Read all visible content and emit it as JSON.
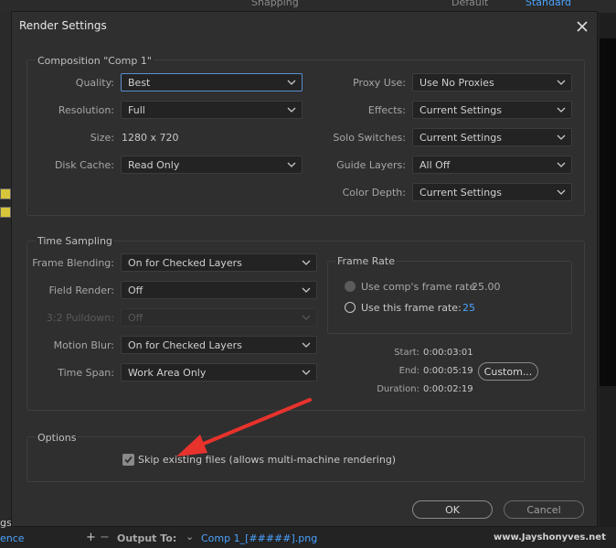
{
  "background": {
    "top_left_text": "Snapping",
    "top_right_tabs": [
      "Default",
      "Standard"
    ],
    "bottom_left_texts": [
      "gs",
      "ence"
    ],
    "output_to_label": "Output To:",
    "output_file": "Comp 1_[#####].png",
    "watermark": "www.Jayshonyves.net"
  },
  "dialog": {
    "title": "Render Settings",
    "composition": {
      "title": "Composition \"Comp 1\"",
      "quality_label": "Quality:",
      "quality_value": "Best",
      "resolution_label": "Resolution:",
      "resolution_value": "Full",
      "size_label": "Size:",
      "size_value": "1280 x 720",
      "disk_cache_label": "Disk Cache:",
      "disk_cache_value": "Read Only",
      "proxy_use_label": "Proxy Use:",
      "proxy_use_value": "Use No Proxies",
      "effects_label": "Effects:",
      "effects_value": "Current Settings",
      "solo_switches_label": "Solo Switches:",
      "solo_switches_value": "Current Settings",
      "guide_layers_label": "Guide Layers:",
      "guide_layers_value": "All Off",
      "color_depth_label": "Color Depth:",
      "color_depth_value": "Current Settings"
    },
    "time_sampling": {
      "title": "Time Sampling",
      "frame_blending_label": "Frame Blending:",
      "frame_blending_value": "On for Checked Layers",
      "field_render_label": "Field Render:",
      "field_render_value": "Off",
      "pulldown_label": "3:2 Pulldown:",
      "pulldown_value": "Off",
      "motion_blur_label": "Motion Blur:",
      "motion_blur_value": "On for Checked Layers",
      "time_span_label": "Time Span:",
      "time_span_value": "Work Area Only",
      "frame_rate": {
        "title": "Frame Rate",
        "use_comp_label": "Use comp's frame rate",
        "use_comp_value": "25.00",
        "use_this_label": "Use this frame rate:",
        "use_this_value": "25"
      },
      "start_label": "Start:",
      "start_value": "0:00:03:01",
      "end_label": "End:",
      "end_value": "0:00:05:19",
      "duration_label": "Duration:",
      "duration_value": "0:00:02:19",
      "custom_button": "Custom..."
    },
    "options": {
      "title": "Options",
      "skip_existing_label": "Skip existing files (allows multi-machine rendering)",
      "skip_existing_checked": true
    },
    "ok_button": "OK",
    "cancel_button": "Cancel"
  },
  "colors": {
    "accent": "#5a8fd0",
    "arrow": "#e8322c",
    "link": "#4aa3ff"
  }
}
